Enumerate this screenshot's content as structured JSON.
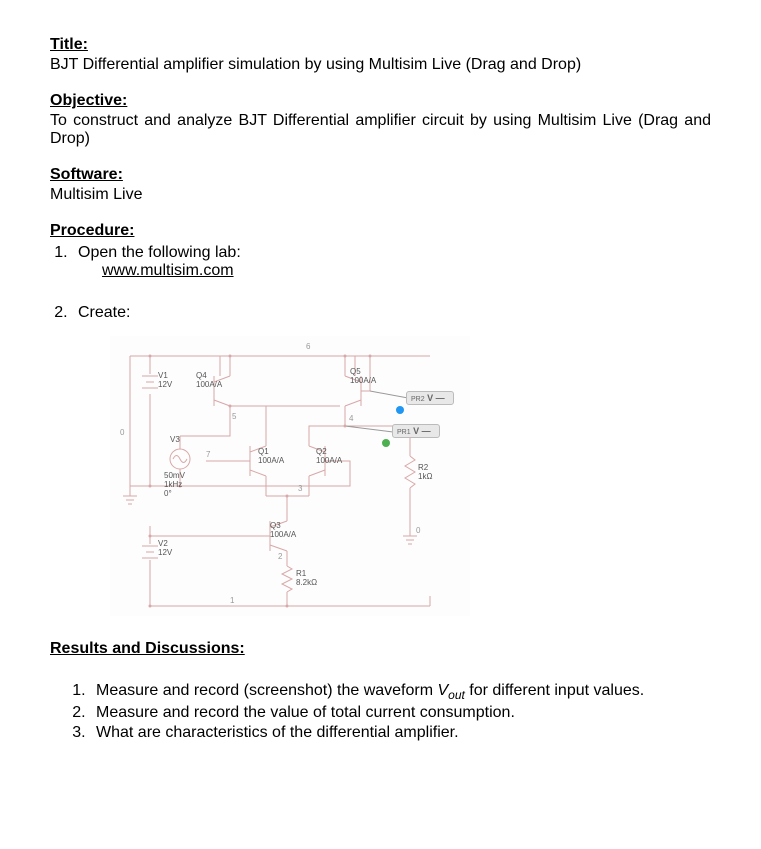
{
  "headings": {
    "title_label": "Title:",
    "objective_label": "Objective:",
    "software_label": "Software:",
    "procedure_label": "Procedure:",
    "results_label": "Results and Discussions:"
  },
  "title_text": "BJT Differential amplifier simulation by using Multisim Live (Drag and Drop)",
  "objective_text": "To construct and analyze BJT Differential amplifier circuit by using Multisim Live (Drag and Drop)",
  "software_text": "Multisim Live",
  "procedure": {
    "step1": "Open the following lab:",
    "link": "www.multisim.com",
    "step2": "Create:"
  },
  "circuit": {
    "V1": {
      "name": "V1",
      "val": "12V"
    },
    "V2": {
      "name": "V2",
      "val": "12V"
    },
    "V3": {
      "name": "V3",
      "val": "50mV\n1kHz\n0°"
    },
    "Q1": {
      "name": "Q1",
      "val": "100A/A"
    },
    "Q2": {
      "name": "Q2",
      "val": "100A/A"
    },
    "Q3": {
      "name": "Q3",
      "val": "100A/A"
    },
    "Q4": {
      "name": "Q4",
      "val": "100A/A"
    },
    "Q5": {
      "name": "Q5",
      "val": "100A/A"
    },
    "R1": {
      "name": "R1",
      "val": "8.2kΩ"
    },
    "R2": {
      "name": "R2",
      "val": "1kΩ"
    },
    "PR1": {
      "name": "PR1",
      "val": "V"
    },
    "PR2": {
      "name": "PR2",
      "val": "V"
    },
    "nodes": {
      "n0a": "0",
      "n0b": "0",
      "n1": "1",
      "n2": "2",
      "n3": "3",
      "n4": "4",
      "n5": "5",
      "n6": "6",
      "n7": "7"
    }
  },
  "results": {
    "r1a": "Measure and record (screenshot) the waveform ",
    "r1_v": "V",
    "r1_sub": "out",
    "r1b": " for different input values.",
    "r2": "Measure and record the value of total current consumption.",
    "r3": "What are characteristics of the differential amplifier."
  }
}
